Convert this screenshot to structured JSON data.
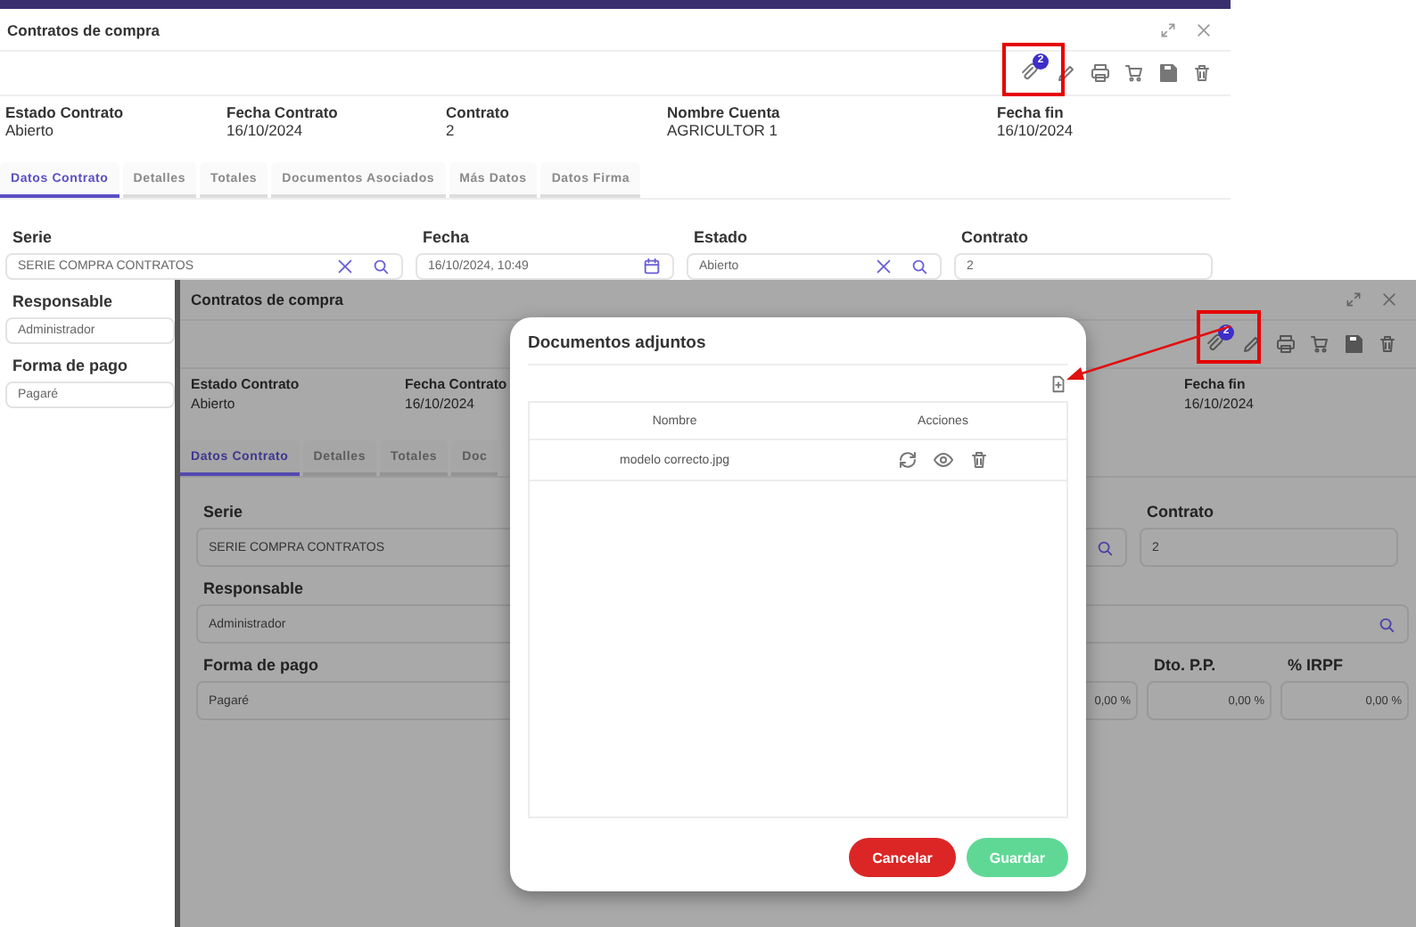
{
  "windows": [
    {
      "kind": "base",
      "title": "Contratos de compra",
      "attachment_badge": "2",
      "header": [
        {
          "label": "Estado Contrato",
          "value": "Abierto"
        },
        {
          "label": "Fecha Contrato",
          "value": "16/10/2024"
        },
        {
          "label": "Contrato",
          "value": "2"
        },
        {
          "label": "Nombre Cuenta",
          "value": "AGRICULTOR 1"
        },
        {
          "label": "Fecha fin",
          "value": "16/10/2024"
        }
      ],
      "tabs": [
        {
          "label": "Datos Contrato",
          "selected": true
        },
        {
          "label": "Detalles",
          "selected": false
        },
        {
          "label": "Totales",
          "selected": false
        },
        {
          "label": "Documentos Asociados",
          "selected": false
        },
        {
          "label": "Más Datos",
          "selected": false
        },
        {
          "label": "Datos Firma",
          "selected": false
        }
      ],
      "form_rows": [
        {
          "kind": "quad",
          "fields": [
            {
              "label": "Serie",
              "value": "SERIE COMPRA CONTRATOS",
              "kind": "clear-search"
            },
            {
              "label": "Fecha",
              "value": "16/10/2024, 10:49",
              "kind": "date"
            },
            {
              "label": "Estado",
              "value": "Abierto",
              "kind": "clear-search"
            },
            {
              "label": "Contrato",
              "value": "2",
              "kind": "text"
            }
          ]
        },
        {
          "kind": "full",
          "fields": [
            {
              "label": "Responsable",
              "value": "Administrador",
              "kind": "text"
            }
          ]
        },
        {
          "kind": "full",
          "fields": [
            {
              "label": "Forma de pago",
              "value": "Pagaré",
              "kind": "text"
            }
          ]
        }
      ]
    },
    {
      "kind": "dimmed",
      "title": "Contratos de compra",
      "attachment_badge": "2",
      "header": [
        {
          "label": "Estado Contrato",
          "value": "Abierto"
        },
        {
          "label": "Fecha Contrato",
          "value": "16/10/2024"
        },
        {
          "label": "Fecha fin",
          "value": "16/10/2024"
        }
      ],
      "tabs": [
        {
          "label": "Datos Contrato",
          "selected": true
        },
        {
          "label": "Detalles",
          "selected": false
        },
        {
          "label": "Totales",
          "selected": false
        },
        {
          "label": "Doc",
          "selected": false
        }
      ],
      "form_rows": [
        {
          "kind": "trio",
          "fields": [
            {
              "label": "Serie",
              "value": "SERIE COMPRA CONTRATOS",
              "kind": "text"
            },
            {
              "kind": "search"
            },
            {
              "label": "Contrato",
              "value": "2",
              "kind": "text"
            }
          ]
        },
        {
          "kind": "full",
          "fields": [
            {
              "label": "Responsable",
              "value": "Administrador",
              "kind": "search"
            }
          ]
        },
        {
          "kind": "pay",
          "fields": [
            {
              "label": "Forma de pago",
              "value": "Pagaré",
              "kind": "text"
            },
            {
              "value": "0,00 %",
              "kind": "number"
            },
            {
              "label": "Dto. P.P.",
              "value": "0,00 %",
              "kind": "number"
            },
            {
              "label": "% IRPF",
              "value": "0,00 %",
              "kind": "number"
            }
          ]
        }
      ]
    }
  ],
  "modal": {
    "title": "Documentos adjuntos",
    "columns": [
      "Nombre",
      "Acciones"
    ],
    "rows": [
      {
        "name": "modelo correcto.jpg"
      }
    ],
    "buttons": [
      {
        "label": "Cancelar",
        "kind": "cancel"
      },
      {
        "label": "Guardar",
        "kind": "save"
      }
    ]
  }
}
